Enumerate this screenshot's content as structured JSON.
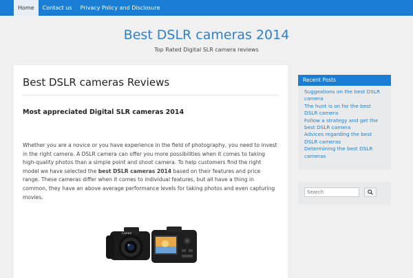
{
  "nav": {
    "items": [
      {
        "label": "Home",
        "active": true
      },
      {
        "label": "Contact us",
        "active": false
      },
      {
        "label": "Privacy Policy and Disclosure",
        "active": false
      }
    ]
  },
  "header": {
    "title": "Best DSLR cameras 2014",
    "tagline": "Top Rated Digital SLR camera reviews"
  },
  "post": {
    "title": "Best DSLR cameras Reviews",
    "subtitle": "Most appreciated Digital SLR cameras 2014",
    "body_before": "Whether you are a novice or you have experience in the field of photography, you need to invest in the right camera. A DSLR camera can offer you more possibilities when it comes to taking high-quality photos than a simple point and shoot camera. To help customers find the right model we have selected the ",
    "body_bold": "best DSLR cameras 2014",
    "body_after": " based on their features and price range. These cameras differ when it comes to individual features, but all have a thing in common, they have an above average performance levels for taking photos and even capturing movies.",
    "camera_brand": "Canon"
  },
  "sidebar": {
    "recent_title": "Recent Posts",
    "recent_posts": [
      "Suggestions on the best DSLR camera",
      "The hunt is on for the best DSLR camera",
      "Follow a strategy and get the best DSLR camera",
      "Advices regarding the best DSLR cameras",
      "Determining the best DSLR cameras"
    ],
    "search_placeholder": "Search",
    "search_icon": "search-icon"
  },
  "colors": {
    "accent": "#1a7fd4",
    "title": "#2e7fc7",
    "background": "#f0f0f0"
  }
}
